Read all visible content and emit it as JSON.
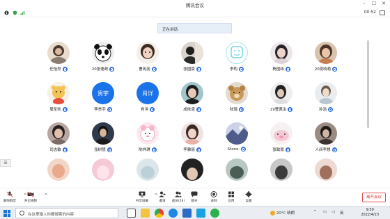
{
  "window": {
    "title": "腾讯会议",
    "timer": "00:52"
  },
  "speaking_banner": "正在讲话:",
  "participants": [
    {
      "name": "任怡然",
      "avatar": "photo"
    },
    {
      "name": "20张逸政",
      "avatar": "photo"
    },
    {
      "name": "曹宪丽",
      "avatar": "photo"
    },
    {
      "name": "张国豪",
      "avatar": "photo"
    },
    {
      "name": "李昀",
      "avatar": "cartoon"
    },
    {
      "name": "杨国纬",
      "avatar": "photo"
    },
    {
      "name": "20吴晓艳",
      "avatar": "photo"
    },
    {
      "name": "周圣凯",
      "avatar": "photo"
    },
    {
      "name": "李贵宇",
      "avatar": "text",
      "avatar_text": "贵宇"
    },
    {
      "name": "肖洋",
      "avatar": "text",
      "avatar_text": "肖详"
    },
    {
      "name": "成依诺",
      "avatar": "photo"
    },
    {
      "name": "陆瑶",
      "avatar": "photo"
    },
    {
      "name": "19曹佩汝",
      "avatar": "photo"
    },
    {
      "name": "孙浩",
      "avatar": "photo"
    },
    {
      "name": "司志敏",
      "avatar": "photo"
    },
    {
      "name": "张树慧",
      "avatar": "photo"
    },
    {
      "name": "陈祥琪",
      "avatar": "photo"
    },
    {
      "name": "李雅丽",
      "avatar": "photo"
    },
    {
      "name": "Stone.",
      "avatar": "photo"
    },
    {
      "name": "张致豪",
      "avatar": "photo"
    },
    {
      "name": "人间李想",
      "avatar": "photo"
    }
  ],
  "side_handle": "☰",
  "controls": {
    "left": [
      {
        "label": "解除静音",
        "icon": "mic-muted-icon"
      },
      {
        "label": "开启视频",
        "icon": "video-off-icon"
      }
    ],
    "center": [
      {
        "label": "共享屏幕",
        "icon": "share-screen-icon"
      },
      {
        "label": "邀请",
        "icon": "invite-icon"
      },
      {
        "label": "成员(29)",
        "icon": "members-icon"
      },
      {
        "label": "聊天",
        "icon": "chat-icon"
      },
      {
        "label": "录制",
        "icon": "record-icon"
      },
      {
        "label": "应用",
        "icon": "apps-icon"
      },
      {
        "label": "设置",
        "icon": "settings-icon"
      }
    ],
    "leave": "离开会议"
  },
  "taskbar": {
    "search_placeholder": "在这里输入你要搜索的内容",
    "weather": "20°C 晴朗",
    "time": "9:59",
    "date": "2022/4/23"
  },
  "colors": {
    "accent_blue": "#1a73e8",
    "leave_red": "#e34d4d",
    "mic_blue": "#2f6fe0"
  }
}
